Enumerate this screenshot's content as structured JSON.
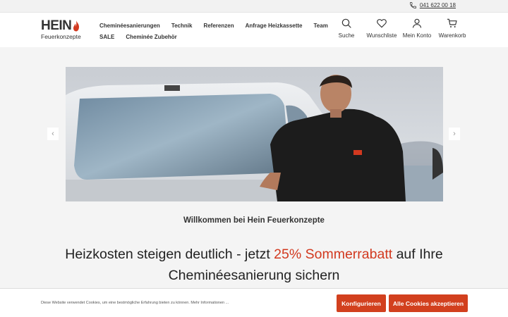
{
  "topbar": {
    "phone": "041 622 00 18",
    "icon": "phone-icon"
  },
  "logo": {
    "title": "HEIN",
    "subtitle": "Feuerkonzepte"
  },
  "nav": {
    "row1": [
      "Cheminéesanierungen",
      "Technik",
      "Referenzen",
      "Anfrage Heizkassette",
      "Team"
    ],
    "row2": [
      "SALE",
      "Cheminée Zubehör"
    ]
  },
  "actions": [
    {
      "label": "Suche",
      "icon": "search-icon"
    },
    {
      "label": "Wunschliste",
      "icon": "heart-icon"
    },
    {
      "label": "Mein Konto",
      "icon": "user-icon"
    },
    {
      "label": "Warenkorb",
      "icon": "cart-icon"
    }
  ],
  "slider": {
    "prev": "‹",
    "next": "›"
  },
  "main": {
    "welcome": "Willkommen bei Hein Feuerkonzepte",
    "headline_pre": "Heizkosten steigen deutlich - jetzt ",
    "headline_accent": "25% Sommerrabatt",
    "headline_post": " auf Ihre Cheminéesanierung sichern"
  },
  "cookie": {
    "message": "Diese Website verwendet Cookies, um eine bestmögliche Erfahrung bieten zu können. Mehr Informationen ...",
    "configure": "Konfigurieren",
    "accept": "Alle Cookies akzeptieren"
  },
  "colors": {
    "accent": "#d2391f",
    "button": "#d2401e"
  }
}
